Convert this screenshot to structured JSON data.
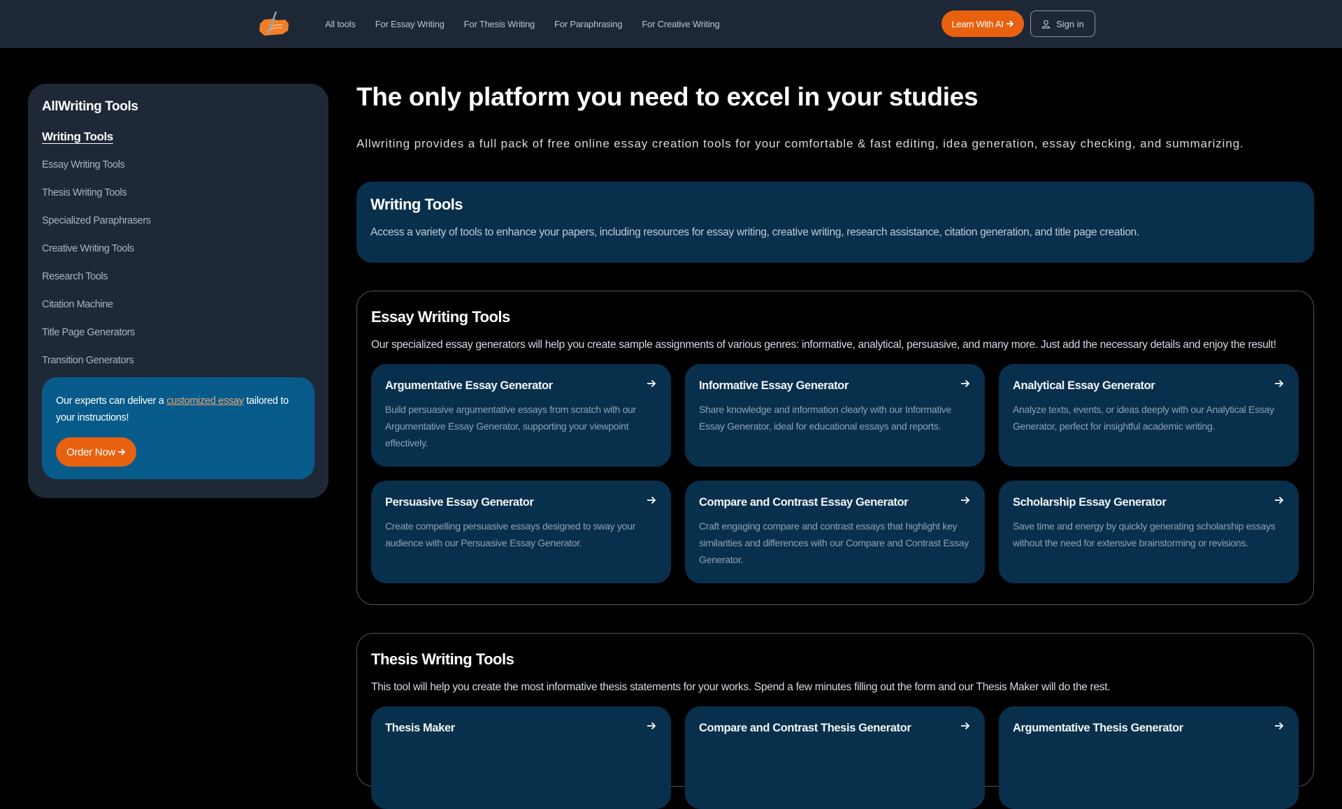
{
  "header": {
    "logo_icon": "quill-paper-logo-icon",
    "nav": [
      "All tools",
      "For Essay Writing",
      "For Thesis Writing",
      "For Paraphrasing",
      "For Creative Writing"
    ],
    "learn_button": "Learn With AI",
    "signin_button": "Sign in",
    "accent": "#e8610f"
  },
  "sidebar": {
    "title": "AllWriting Tools",
    "active_section": "Writing Tools",
    "items": [
      "Essay Writing Tools",
      "Thesis Writing Tools",
      "Specialized Paraphrasers",
      "Creative Writing Tools",
      "Research Tools",
      "Citation Machine",
      "Title Page Generators",
      "Transition Generators"
    ],
    "promo": {
      "text_before": "Our experts can deliver a ",
      "link_text": "customized essay",
      "text_after": " tailored to your instructions!",
      "button": "Order Now"
    }
  },
  "main": {
    "title": "The only platform you need to excel in your studies",
    "intro": "Allwriting provides a full pack of free online essay creation tools for your comfortable & fast editing, idea generation, essay checking, and summarizing.",
    "writing_tools": {
      "heading": "Writing Tools",
      "text": "Access a variety of tools to enhance your papers, including resources for essay writing, creative writing, research assistance, citation generation, and title page creation."
    },
    "essay": {
      "heading": "Essay Writing Tools",
      "text": "Our specialized essay generators will help you create sample assignments of various genres: informative, analytical, persuasive, and many more. Just add the necessary details and enjoy the result!",
      "cards": [
        {
          "title": "Argumentative Essay Generator",
          "text": "Build persuasive argumentative essays from scratch with our Argumentative Essay Generator, supporting your viewpoint effectively."
        },
        {
          "title": "Informative Essay Generator",
          "text": "Share knowledge and information clearly with our Informative Essay Generator, ideal for educational essays and reports."
        },
        {
          "title": "Analytical Essay Generator",
          "text": "Analyze texts, events, or ideas deeply with our Analytical Essay Generator, perfect for insightful academic writing."
        },
        {
          "title": "Persuasive Essay Generator",
          "text": "Create compelling persuasive essays designed to sway your audience with our Persuasive Essay Generator."
        },
        {
          "title": "Compare and Contrast Essay Generator",
          "text": "Craft engaging compare and contrast essays that highlight key similarities and differences with our Compare and Contrast Essay Generator."
        },
        {
          "title": "Scholarship Essay Generator",
          "text": "Save time and energy by quickly generating scholarship essays without the need for extensive brainstorming or revisions."
        }
      ]
    },
    "thesis": {
      "heading": "Thesis Writing Tools",
      "text": "This tool will help you create the most informative thesis statements for your works. Spend a few minutes filling out the form and our Thesis Maker will do the rest.",
      "cards": [
        {
          "title": "Thesis Maker"
        },
        {
          "title": "Compare and Contrast Thesis Generator"
        },
        {
          "title": "Argumentative Thesis Generator"
        }
      ]
    }
  }
}
